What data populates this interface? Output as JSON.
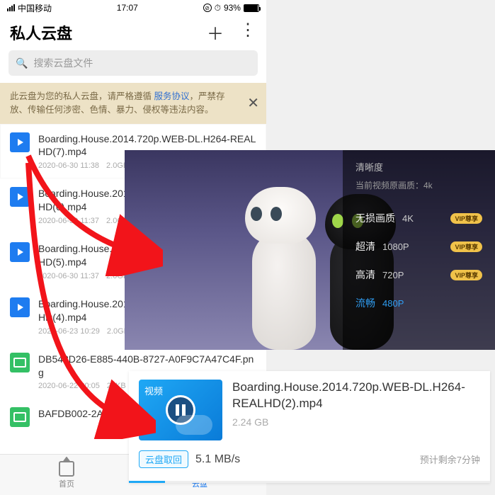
{
  "statusbar": {
    "carrier": "中国移动",
    "time": "17:07",
    "alarm": "⊙",
    "battery_pct": "93%"
  },
  "header": {
    "title": "私人云盘"
  },
  "search": {
    "placeholder": "搜索云盘文件"
  },
  "notice": {
    "pre": "此云盘为您的私人云盘，请严格遵循 ",
    "link": "服务协议",
    "post": "，严禁存放、传输任何涉密、色情、暴力、侵权等违法内容。"
  },
  "files": [
    {
      "type": "video",
      "name": "Boarding.House.2014.720p.WEB-DL.H264-REALHD(7).mp4",
      "date": "2020-06-30 11:38",
      "size": "2.0GB"
    },
    {
      "type": "video",
      "name": "Boarding.House.2014.720p.WEB-DL.H264-REALHD(6).mp4",
      "date": "2020-06-30 11:37",
      "size": "2.0GB"
    },
    {
      "type": "video",
      "name": "Boarding.House.2014.720p.WEB-DL.H264-REALHD(5).mp4",
      "date": "2020-06-30 11:37",
      "size": "2.0GB"
    },
    {
      "type": "video",
      "name": "Boarding.House.2014.720p.WEB-DL.H264-REALHD(4).mp4",
      "date": "2020-06-23 10:29",
      "size": "2.0GB"
    },
    {
      "type": "image",
      "name": "DB548D26-E885-440B-8727-A0F9C7A47C4F.png",
      "date": "2020-06-22 20:05",
      "size": "29KB"
    },
    {
      "type": "image",
      "name": "BAFDB002-2A7163018.png",
      "date": "",
      "size": ""
    }
  ],
  "tabs": {
    "home": "首页",
    "cloud": "云盘"
  },
  "quality": {
    "title": "清晰度",
    "original": "当前视频原画质：4k",
    "options": [
      {
        "cn": "无损画质",
        "res": "4K",
        "vip": "VIP尊享"
      },
      {
        "cn": "超清",
        "res": "1080P",
        "vip": "VIP尊享"
      },
      {
        "cn": "高清",
        "res": "720P",
        "vip": "VIP尊享"
      },
      {
        "cn": "流畅",
        "res": "480P",
        "vip": ""
      }
    ]
  },
  "download": {
    "tag": "视频",
    "filename": "Boarding.House.2014.720p.WEB-DL.H264-REALHD(2).mp4",
    "filesize": "2.24 GB",
    "action": "云盘取回",
    "speed": "5.1 MB/s",
    "eta": "预计剩余7分钟"
  }
}
